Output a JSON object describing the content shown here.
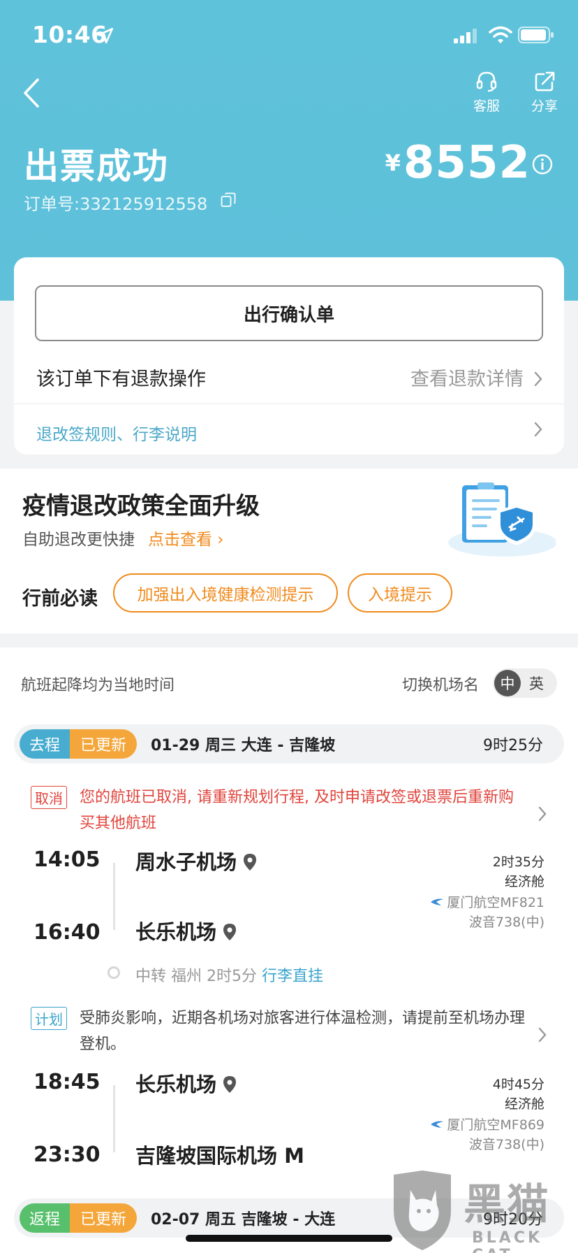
{
  "status_bar": {
    "time": "10:46"
  },
  "header": {
    "service_label": "客服",
    "share_label": "分享",
    "title": "出票成功",
    "order_no": "订单号:332125912558",
    "price_symbol": "¥",
    "price": "8552"
  },
  "card": {
    "confirm_label": "出行确认单",
    "refund_text": "该订单下有退款操作",
    "refund_link": "查看退款详情",
    "rules_text": "退改签规则、行李说明"
  },
  "promo": {
    "title": "疫情退改政策全面升级",
    "subtitle": "自助退改更快捷",
    "link": "点击查看 ›",
    "read_label": "行前必读",
    "pills": [
      "加强出入境健康检测提示",
      "入境提示"
    ]
  },
  "flights": {
    "local_note": "航班起降均为当地时间",
    "switch_label": "切换机场名",
    "lang_zh": "中",
    "lang_en": "英",
    "outbound": {
      "tag": "去程",
      "status": "已更新",
      "info": "01-29  周三  大连 - 吉隆坡",
      "duration": "9时25分",
      "notice_tag": "取消",
      "notice_text": "您的航班已取消, 请重新规划行程, 及时申请改签或退票后重新购买其他航班",
      "leg1": {
        "dep_time": "14:05",
        "dep_airport": "周水子机场",
        "arr_time": "16:40",
        "arr_airport": "长乐机场",
        "duration": "2时35分",
        "cabin": "经济舱",
        "airline": "厦门航空MF821",
        "aircraft": "波音738(中)"
      },
      "transfer": "中转 福州 2时5分",
      "transfer_baggage": "行李直挂",
      "plan_tag": "计划",
      "plan_text": "受肺炎影响，近期各机场对旅客进行体温检测，请提前至机场办理登机。",
      "leg2": {
        "dep_time": "18:45",
        "dep_airport": "长乐机场",
        "arr_time": "23:30",
        "arr_airport": "吉隆坡国际机场 M",
        "duration": "4时45分",
        "cabin": "经济舱",
        "airline": "厦门航空MF869",
        "aircraft": "波音738(中)"
      }
    },
    "return": {
      "tag": "返程",
      "status": "已更新",
      "info": "02-07  周五  吉隆坡 - 大连",
      "duration": "9时20分"
    }
  },
  "watermark": {
    "cn": "黑猫",
    "en": "BLACK CAT"
  },
  "colors": {
    "header_bg": "#5ec0d9",
    "accent_orange": "#f08a1c",
    "link_blue": "#4aa8c8",
    "cancel_red": "#e0443c"
  }
}
